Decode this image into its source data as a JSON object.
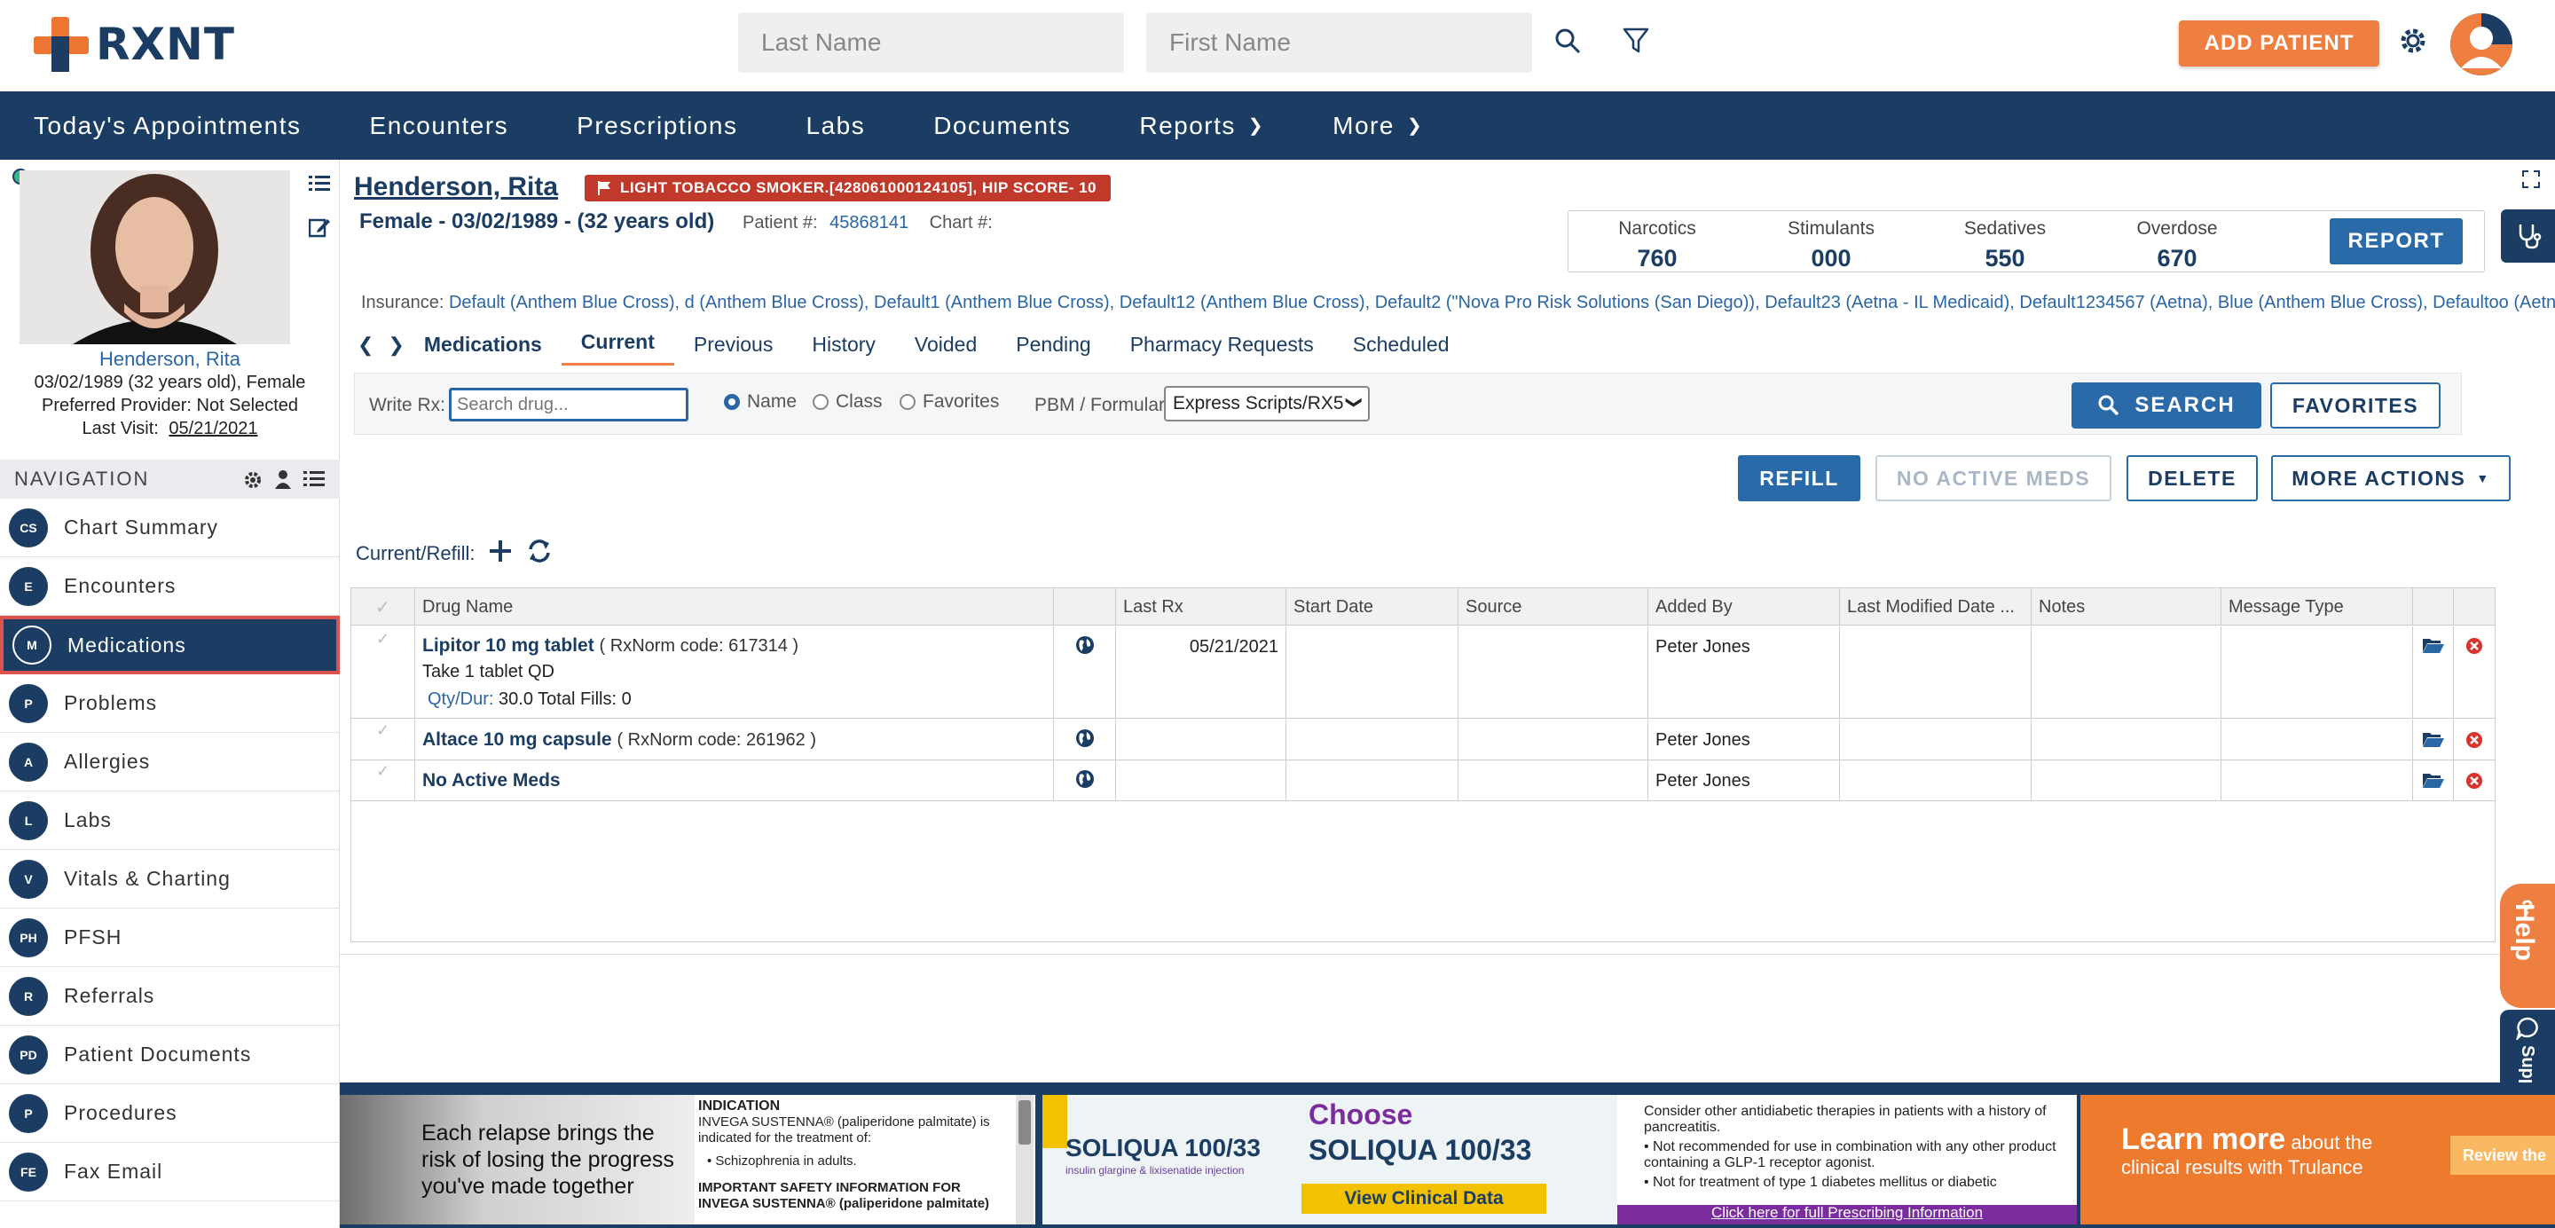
{
  "header": {
    "logo_text": "RXNT",
    "last_name_placeholder": "Last Name",
    "first_name_placeholder": "First Name",
    "add_patient_label": "ADD PATIENT"
  },
  "nav": {
    "items": [
      {
        "label": "Today's Appointments"
      },
      {
        "label": "Encounters"
      },
      {
        "label": "Prescriptions"
      },
      {
        "label": "Labs"
      },
      {
        "label": "Documents"
      },
      {
        "label": "Reports"
      },
      {
        "label": "More"
      }
    ]
  },
  "patient_card": {
    "name": "Henderson, Rita",
    "dob_line": "03/02/1989 (32 years old), Female",
    "provider_line": "Preferred Provider: Not Selected",
    "last_visit_label": "Last Visit:",
    "last_visit_date": "05/21/2021"
  },
  "side_nav": {
    "header": "NAVIGATION",
    "items": [
      {
        "badge": "CS",
        "label": "Chart Summary"
      },
      {
        "badge": "E",
        "label": "Encounters"
      },
      {
        "badge": "M",
        "label": "Medications"
      },
      {
        "badge": "P",
        "label": "Problems"
      },
      {
        "badge": "A",
        "label": "Allergies"
      },
      {
        "badge": "L",
        "label": "Labs"
      },
      {
        "badge": "V",
        "label": "Vitals & Charting"
      },
      {
        "badge": "PH",
        "label": "PFSH"
      },
      {
        "badge": "R",
        "label": "Referrals"
      },
      {
        "badge": "PD",
        "label": "Patient Documents"
      },
      {
        "badge": "P",
        "label": "Procedures"
      },
      {
        "badge": "FE",
        "label": "Fax Email"
      }
    ]
  },
  "patient_header": {
    "name": "Henderson, Rita",
    "alert": "LIGHT TOBACCO SMOKER.[428061000124105], HIP SCORE- 10",
    "sub": "Female - 03/02/1989 - (32 years old)",
    "patient_num_label": "Patient #:",
    "patient_num": "45868141",
    "chart_label": "Chart #:",
    "insurance_label": "Insurance:",
    "insurance": "Default (Anthem Blue Cross), d (Anthem Blue Cross), Default1 (Anthem Blue Cross), Default12 (Anthem Blue Cross), Default2 (\"Nova Pro Risk Solutions (San Diego)), Default23 (Aetna - IL Medicaid), Default1234567 (Aetna), Blue (Anthem Blue Cross), Defaultoo (Aetna)"
  },
  "scores": [
    {
      "label": "Narcotics",
      "value": "760"
    },
    {
      "label": "Stimulants",
      "value": "000"
    },
    {
      "label": "Sedatives",
      "value": "550"
    },
    {
      "label": "Overdose",
      "value": "670"
    }
  ],
  "report_label": "REPORT",
  "tabs": {
    "title": "Medications",
    "items": [
      "Current",
      "Previous",
      "History",
      "Voided",
      "Pending",
      "Pharmacy Requests",
      "Scheduled"
    ]
  },
  "rx_bar": {
    "write_label": "Write Rx:",
    "search_placeholder": "Search drug...",
    "radio_name": "Name",
    "radio_class": "Class",
    "radio_favorites": "Favorites",
    "pbm_label": "PBM / Formulary:",
    "pbm_value": "Express Scripts/RX5",
    "search_label": "SEARCH",
    "favorites_label": "FAVORITES"
  },
  "actions": {
    "refill": "REFILL",
    "no_active": "NO ACTIVE MEDS",
    "delete": "DELETE",
    "more": "MORE ACTIONS"
  },
  "current_refill_label": "Current/Refill:",
  "table": {
    "headers": [
      "Drug Name",
      "Last Rx",
      "Start Date",
      "Source",
      "Added By",
      "Last Modified Date ...",
      "Notes",
      "Message Type"
    ],
    "rows": [
      {
        "drug": "Lipitor 10 mg tablet",
        "rxnorm": "( RxNorm code: 617314 )",
        "sig": "Take 1 tablet QD",
        "qty_label": "Qty/Dur:",
        "qty": "30.0 Total Fills: 0",
        "last_rx": "05/21/2021",
        "added_by": "Peter Jones"
      },
      {
        "drug": "Altace 10 mg capsule",
        "rxnorm": "( RxNorm code: 261962 )",
        "added_by": "Peter Jones"
      },
      {
        "drug": "No Active Meds",
        "added_by": "Peter Jones"
      }
    ]
  },
  "ads": {
    "ad1_headline": "Each relapse brings the risk of losing the progress you've made together",
    "ad1_indication_title": "INDICATION",
    "ad1_indication": "INVEGA SUSTENNA® (paliperidone palmitate) is indicated for the treatment of:",
    "ad1_bullet": "Schizophrenia in adults.",
    "ad1_safety": "IMPORTANT SAFETY INFORMATION FOR INVEGA SUSTENNA® (paliperidone palmitate)",
    "ad2_brand": "SOLIQUA 100/33",
    "ad2_tag": "insulin glargine & lixisenatide injection",
    "ad2_choose": "Choose",
    "ad2_product": "SOLIQUA 100/33",
    "ad2_cta": "View Clinical Data",
    "ad2_text1": "Consider other antidiabetic therapies in patients with a history of pancreatitis.",
    "ad2_bullet1": "Not recommended for use in combination with any other product containing a GLP-1 receptor agonist.",
    "ad2_bullet2": "Not for treatment of type 1 diabetes mellitus or diabetic",
    "ad2_link": "Click here for full Prescribing Information",
    "ad3_title": "Learn more",
    "ad3_text": "about the clinical results with Trulance",
    "ad3_btn": "Review the"
  },
  "help_label": "Help",
  "support_label": "Support",
  "colors": {
    "navy": "#1b3d63",
    "accent_orange": "#ef7f41",
    "link_blue": "#2a65a5",
    "alert_red": "#c0392b"
  }
}
